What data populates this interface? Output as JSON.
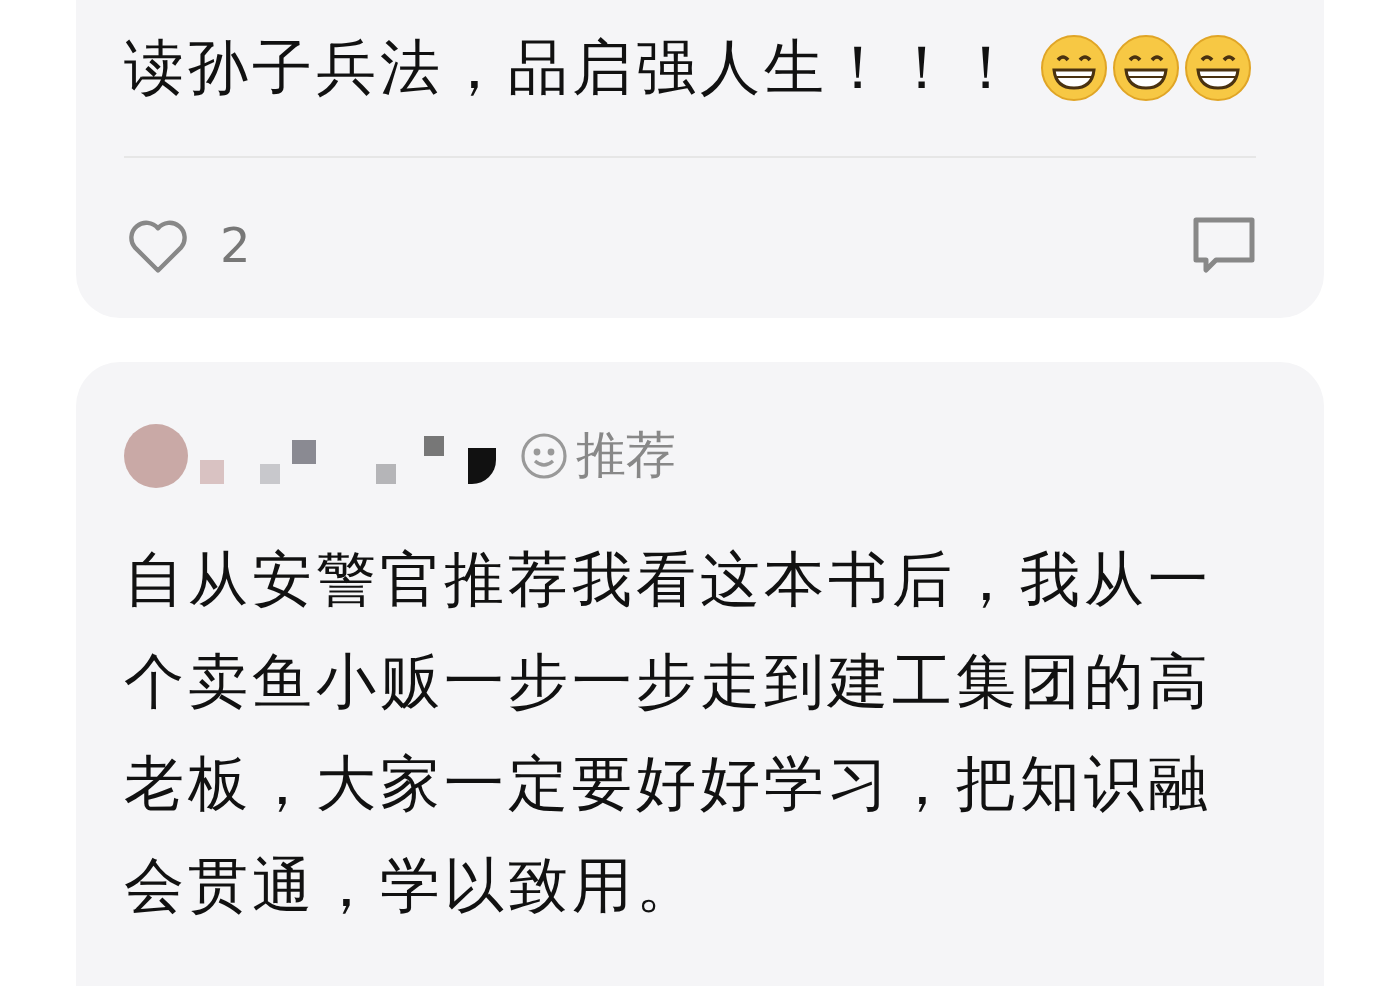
{
  "posts": [
    {
      "text": "读孙子兵法，品启强人生！！！",
      "emojis": [
        {
          "kind": "grin"
        },
        {
          "kind": "grin"
        },
        {
          "kind": "grin"
        }
      ],
      "likes": "2"
    },
    {
      "badge": "推荐",
      "text": "自从安警官推荐我看这本书后，我从一个卖鱼小贩一步一步走到建工集团的高老板，大家一定要好好学习，把知识融会贯通，学以致用。"
    }
  ]
}
